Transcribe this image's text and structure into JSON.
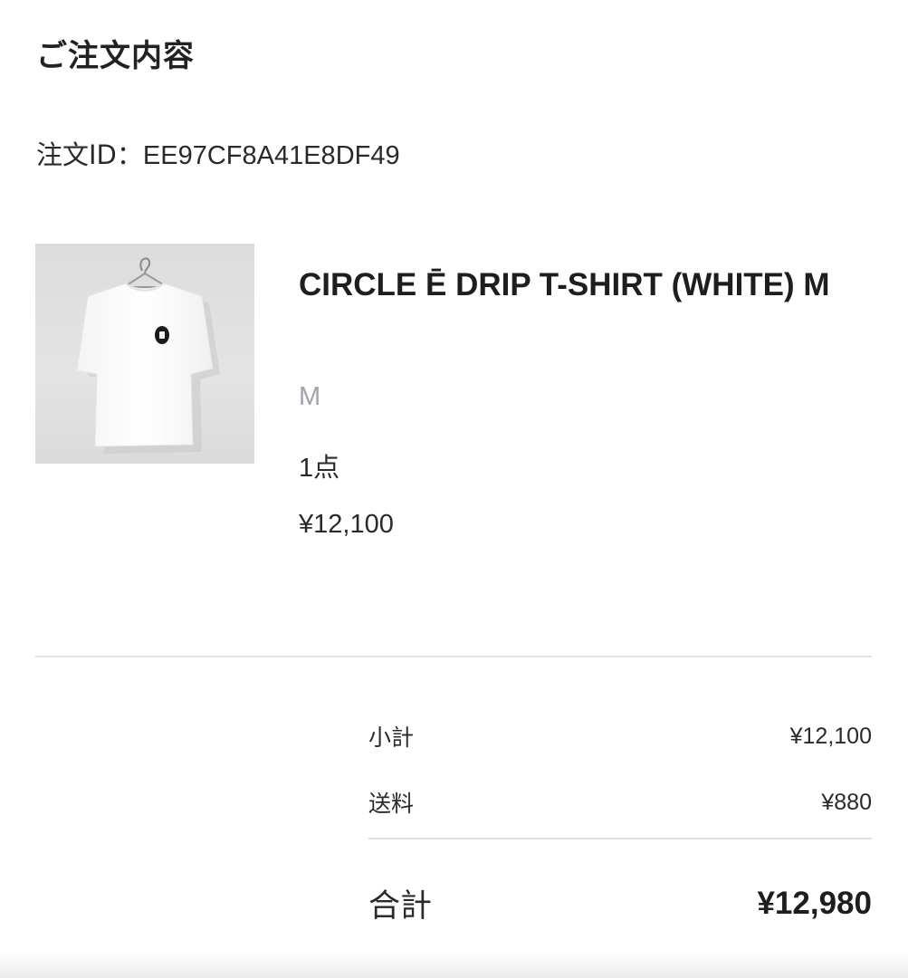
{
  "page": {
    "title": "ご注文内容"
  },
  "order": {
    "id_label": "注文ID：",
    "id_value": "EE97CF8A41E8DF49"
  },
  "product": {
    "image_icon": "tshirt-photo",
    "name": "CIRCLE Ē DRIP T-SHIRT (WHITE) M",
    "variant": "M",
    "quantity": "1点",
    "price": "¥12,100"
  },
  "summary": {
    "subtotal_label": "小計",
    "subtotal_value": "¥12,100",
    "shipping_label": "送料",
    "shipping_value": "¥880",
    "total_label": "合計",
    "total_value": "¥12,980"
  },
  "colors": {
    "variant_text": "#a0a3ad",
    "divider": "#e3e3e6"
  }
}
